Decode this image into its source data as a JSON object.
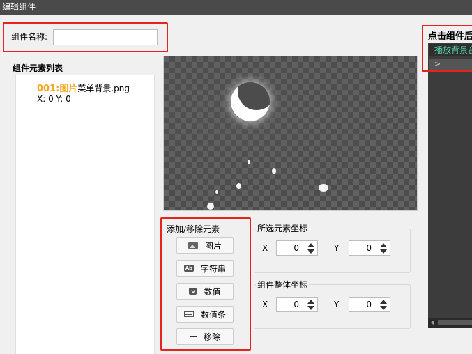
{
  "window": {
    "title": "编辑组件"
  },
  "component_name": {
    "label": "组件名称:",
    "value": ""
  },
  "element_list": {
    "title": "组件元素列表",
    "items": [
      {
        "index": "001:",
        "type": "图片",
        "name": "菜单背景.png",
        "coords": "X: 0 Y: 0"
      }
    ]
  },
  "add_remove": {
    "title": "添加/移除元素",
    "buttons": [
      {
        "label": "图片",
        "icon": "image-icon"
      },
      {
        "label": "字符串",
        "icon": "text-icon"
      },
      {
        "label": "数值",
        "icon": "value-icon"
      },
      {
        "label": "数值条",
        "icon": "bar-icon"
      },
      {
        "label": "移除",
        "icon": "minus-icon"
      }
    ]
  },
  "selected_coords": {
    "title": "所选元素坐标",
    "x_label": "X",
    "y_label": "Y",
    "x": "0",
    "y": "0"
  },
  "whole_coords": {
    "title": "组件整体坐标",
    "x_label": "X",
    "y_label": "Y",
    "x": "0",
    "y": "0"
  },
  "right_panel": {
    "title": "点击组件后",
    "items": [
      "播放背景音",
      ">"
    ]
  },
  "colors": {
    "highlight": "#e6241b",
    "index": "#f5a623",
    "event_text": "#4fd1a5"
  }
}
